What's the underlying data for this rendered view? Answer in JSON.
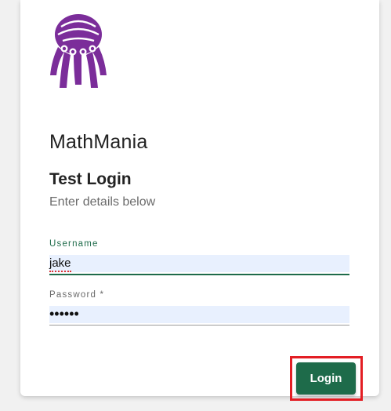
{
  "app": {
    "name": "MathMania",
    "logo_icon": "jellyfish-logo-icon",
    "logo_color": "#7b2d9a"
  },
  "form": {
    "title": "Test Login",
    "subtitle": "Enter details below",
    "username": {
      "label": "Username",
      "value": "jake"
    },
    "password": {
      "label": "Password *",
      "masked_value": "••••••"
    },
    "submit_label": "Login"
  },
  "colors": {
    "accent": "#1e6b4a",
    "autofill_background": "#e8f0fe",
    "highlight_box": "#e31e24"
  }
}
